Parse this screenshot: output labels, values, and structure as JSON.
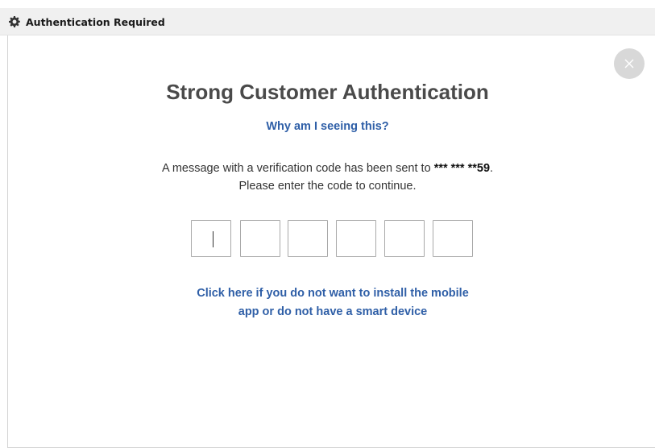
{
  "window": {
    "title": "Authentication Required"
  },
  "dialog": {
    "heading": "Strong Customer Authentication",
    "why_link": "Why am I seeing this?",
    "message_prefix": "A message with a verification code has been sent to ",
    "masked_phone": "*** *** **59",
    "message_suffix": ".",
    "message_line2": "Please enter the code to continue.",
    "code_digits": [
      "",
      "",
      "",
      "",
      "",
      ""
    ],
    "alt_link_line1": "Click here if you do not want to install the mobile",
    "alt_link_line2": "app or do not have a smart device"
  },
  "icons": {
    "title": "gear-icon",
    "close": "close-icon"
  },
  "colors": {
    "link": "#2f5fa7",
    "heading": "#4a4a4a",
    "close_button_bg": "#d8d8d8"
  }
}
